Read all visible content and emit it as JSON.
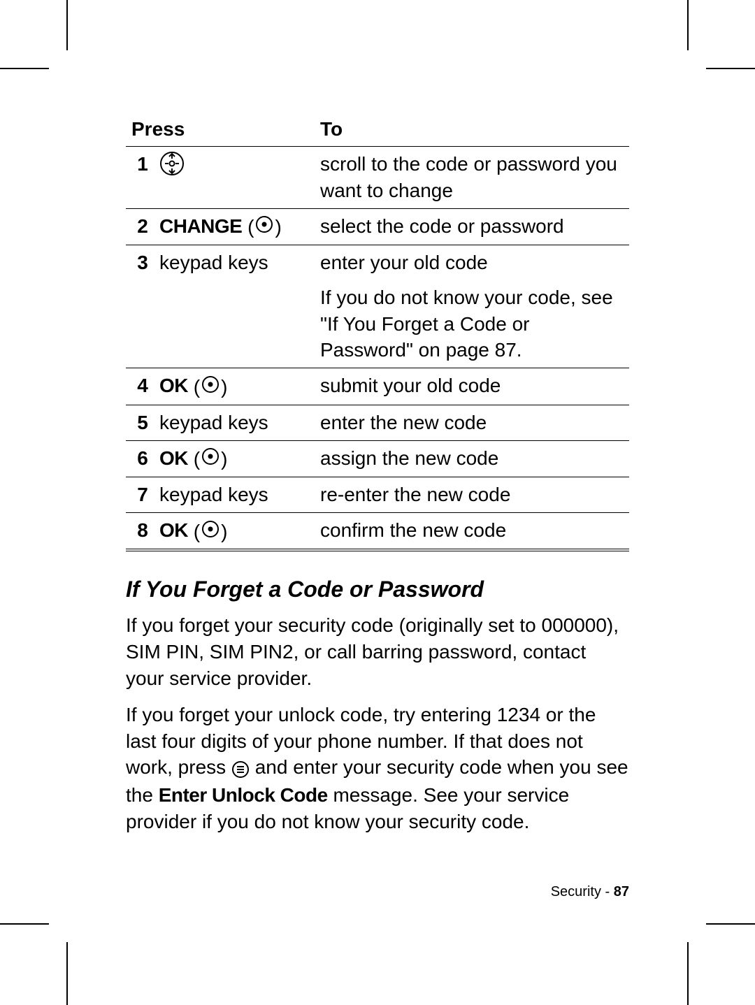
{
  "table": {
    "headers": {
      "press": "Press",
      "to": "To"
    },
    "rows": [
      {
        "num": "1",
        "press_type": "nav-icon",
        "to": "scroll to the code or password you want to change"
      },
      {
        "num": "2",
        "press_type": "label-center",
        "label": "CHANGE",
        "to": "select the code or password"
      },
      {
        "num": "3",
        "press_type": "text",
        "text": "keypad keys",
        "to": "enter your old code"
      },
      {
        "num": "",
        "press_type": "empty",
        "to": "If you do not know your code, see \"If You Forget a Code or Password\" on page 87."
      },
      {
        "num": "4",
        "press_type": "label-center",
        "label": "OK",
        "to": "submit your old code"
      },
      {
        "num": "5",
        "press_type": "text",
        "text": "keypad keys",
        "to": "enter the new code"
      },
      {
        "num": "6",
        "press_type": "label-center",
        "label": "OK",
        "to": "assign the new code"
      },
      {
        "num": "7",
        "press_type": "text",
        "text": "keypad keys",
        "to": "re-enter the new code"
      },
      {
        "num": "8",
        "press_type": "label-center",
        "label": "OK",
        "to": "confirm the new code"
      }
    ]
  },
  "section_heading": "If You Forget a Code or Password",
  "para1": "If you forget your security code (originally set to 000000), SIM PIN, SIM PIN2, or call barring password, contact your service provider.",
  "para2_a": "If you forget your unlock code, try entering 1234 or the last four digits of your phone number. If that does not work, press ",
  "para2_b": " and enter your security code when you see the ",
  "para2_label": "Enter Unlock Code",
  "para2_c": " message. See your service provider if you do not know your security code.",
  "footer": {
    "section": "Security",
    "sep": " - ",
    "page": "87"
  }
}
